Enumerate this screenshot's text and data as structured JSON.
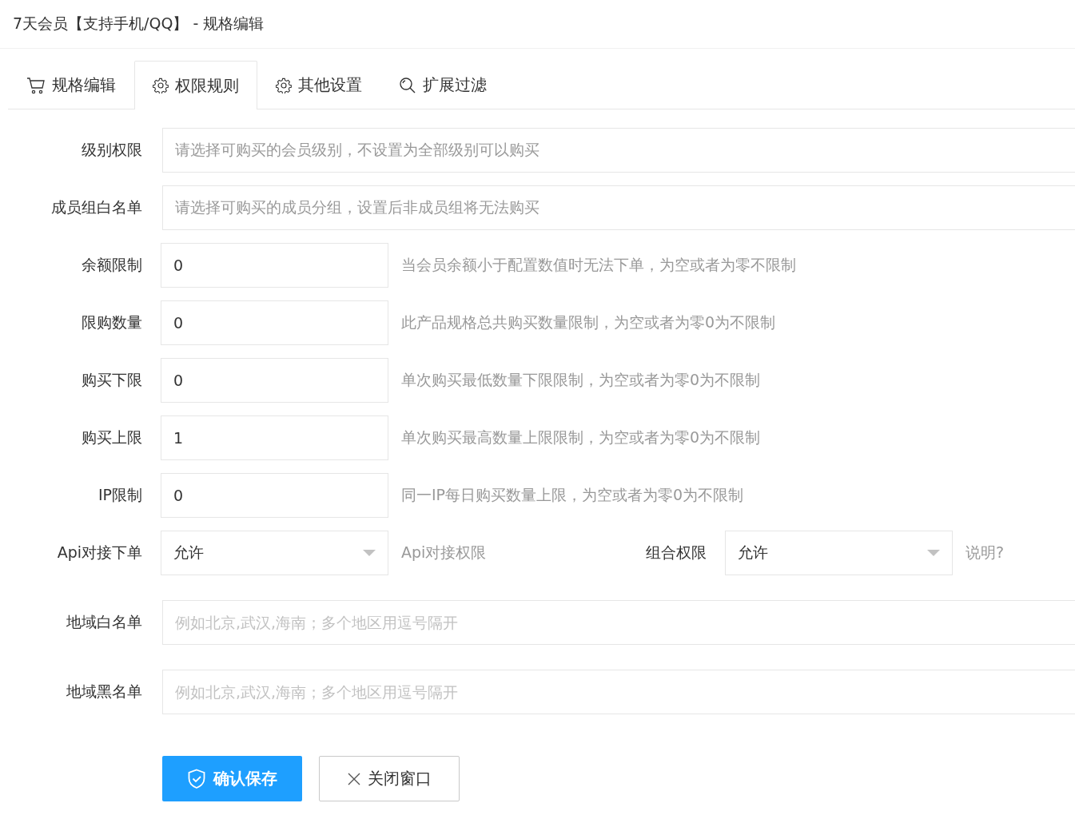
{
  "title": "7天会员【支持手机/QQ】 - 规格编辑",
  "tabs": [
    {
      "label": "规格编辑",
      "selected": false
    },
    {
      "label": "权限规则",
      "selected": true
    },
    {
      "label": "其他设置",
      "selected": false
    },
    {
      "label": "扩展过滤",
      "selected": false
    }
  ],
  "fields": [
    {
      "kind": "picker",
      "label": "级别权限",
      "placeholder": "请选择可购买的会员级别，不设置为全部级别可以购买"
    },
    {
      "kind": "picker",
      "label": "成员组白名单",
      "placeholder": "请选择可购买的成员分组，设置后非成员组将无法购买"
    },
    {
      "kind": "input",
      "label": "余额限制",
      "value": "0",
      "hint": "当会员余额小于配置数值时无法下单，为空或者为零不限制"
    },
    {
      "kind": "input",
      "label": "限购数量",
      "value": "0",
      "hint": "此产品规格总共购买数量限制，为空或者为零0为不限制"
    },
    {
      "kind": "input",
      "label": "购买下限",
      "value": "0",
      "hint": "单次购买最低数量下限限制，为空或者为零0为不限制"
    },
    {
      "kind": "input",
      "label": "购买上限",
      "value": "1",
      "hint": "单次购买最高数量上限限制，为空或者为零0为不限制"
    },
    {
      "kind": "input",
      "label": "IP限制",
      "value": "0",
      "hint": "同一IP每日购买数量上限，为空或者为零0为不限制"
    },
    {
      "kind": "selects",
      "label": "Api对接下单",
      "value": "允许",
      "hint": "Api对接权限",
      "label_2": "组合权限",
      "value_2": "允许",
      "help": "说明?"
    },
    {
      "kind": "text",
      "label": "地域白名单",
      "placeholder": "例如北京,武汉,海南；多个地区用逗号隔开"
    },
    {
      "kind": "text",
      "label": "地域黑名单",
      "placeholder": "例如北京,武汉,海南；多个地区用逗号隔开"
    }
  ],
  "buttons": [
    {
      "kind": "primary",
      "label": "确认保存"
    },
    {
      "kind": "close",
      "label": "关闭窗口"
    }
  ]
}
